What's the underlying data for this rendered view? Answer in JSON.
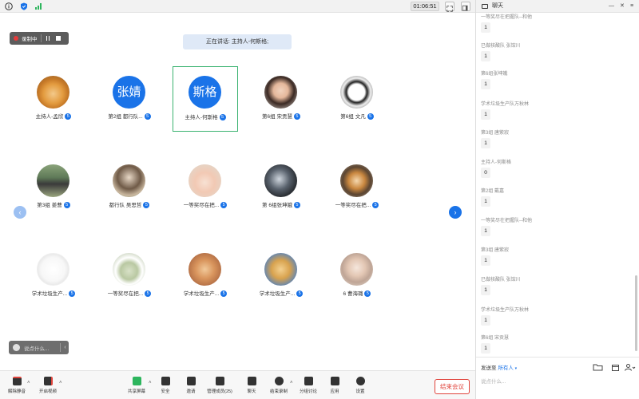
{
  "topbar": {
    "timer": "01:06:51",
    "icons": [
      "info-icon",
      "shield-icon",
      "signal-icon",
      "fullscreen-icon",
      "layout-icon"
    ]
  },
  "recording": {
    "label": "录制中"
  },
  "speaking": "正在讲话: 主持人-何斯格;",
  "grid": {
    "tiles": [
      {
        "name": "主持人-孟欣",
        "avatar": "photo-dog",
        "active": false
      },
      {
        "name": "第2组 都行队...",
        "avatar": "text",
        "avatar_text": "张婧",
        "active": false
      },
      {
        "name": "主持人-何斯格",
        "avatar": "text",
        "avatar_text": "斯格",
        "active": true
      },
      {
        "name": "第6组 宋贡慧",
        "avatar": "photo-woman",
        "active": false
      },
      {
        "name": "第6组 文凡",
        "avatar": "photo-comic",
        "active": false
      },
      {
        "name": "第3组 姜曹",
        "avatar": "photo-outdoor",
        "active": false
      },
      {
        "name": "都行队 吴思哲",
        "avatar": "photo-portrait",
        "active": false
      },
      {
        "name": "一等奖尽在把...",
        "avatar": "photo-cartoon",
        "active": false
      },
      {
        "name": "第 6组张坤娥",
        "avatar": "photo-dark",
        "active": false
      },
      {
        "name": "一等奖尽在把...",
        "avatar": "photo-tiger",
        "active": false
      },
      {
        "name": "学术垃圾生产...",
        "avatar": "photo-drawing",
        "active": false
      },
      {
        "name": "一等奖尽在把...",
        "avatar": "photo-group",
        "active": false
      },
      {
        "name": "学术垃圾生产...",
        "avatar": "photo-pet",
        "active": false
      },
      {
        "name": "学术垃圾生产...",
        "avatar": "photo-doge",
        "active": false
      },
      {
        "name": "6 曹海璐",
        "avatar": "photo-girl",
        "active": false
      }
    ],
    "mic_badge": "5"
  },
  "say_placeholder": "说点什么...",
  "toolbar": {
    "items": [
      {
        "label": "解除静音",
        "icon": "mic-off-icon"
      },
      {
        "label": "开启视频",
        "icon": "video-off-icon"
      },
      {
        "label": "共享屏幕",
        "icon": "share-screen-icon"
      },
      {
        "label": "安全",
        "icon": "security-icon"
      },
      {
        "label": "邀请",
        "icon": "invite-icon"
      },
      {
        "label": "管理成员(25)",
        "icon": "members-icon"
      },
      {
        "label": "聊天",
        "icon": "chat-icon"
      },
      {
        "label": "结束录制",
        "icon": "record-stop-icon"
      },
      {
        "label": "分组讨论",
        "icon": "breakout-icon"
      },
      {
        "label": "应用",
        "icon": "apps-icon"
      },
      {
        "label": "设置",
        "icon": "settings-icon"
      }
    ],
    "end_label": "结束会议"
  },
  "chat": {
    "title": "聊天",
    "messages": [
      {
        "name": "一等奖尽在把握队--和他",
        "value": "1"
      },
      {
        "name": "已做核酸队 张馆川",
        "value": "1"
      },
      {
        "name": "第6组张坤娥",
        "value": "1"
      },
      {
        "name": "学术垃圾生产队万秋林",
        "value": "1"
      },
      {
        "name": "第3组 唐紫寂",
        "value": "1"
      },
      {
        "name": "主持人-何斯格",
        "value": "0"
      },
      {
        "name": "第2组 戴嘉",
        "value": "1"
      },
      {
        "name": "一等奖尽在把握队--和他",
        "value": "1"
      },
      {
        "name": "第3组 唐紫寂",
        "value": "1"
      },
      {
        "name": "已做核酸队 张馆川",
        "value": "1"
      },
      {
        "name": "学术垃圾生产队万秋林",
        "value": "1"
      },
      {
        "name": "第6组 宋贡慧",
        "value": "1"
      }
    ],
    "send_to_label": "发送至",
    "send_to_value": "所有人",
    "input_placeholder": "说点什么..."
  }
}
